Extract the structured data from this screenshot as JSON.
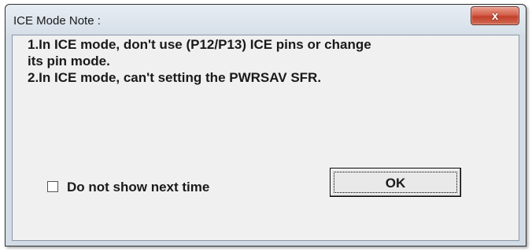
{
  "window": {
    "title": "ICE Mode Note :",
    "close_glyph": "x",
    "close_icon": "close-icon"
  },
  "message": {
    "text": "1.In ICE mode, don't use (P12/P13) ICE pins or change\nits pin mode.\n2.In ICE mode, can't setting the PWRSAV SFR."
  },
  "checkbox": {
    "label": "Do not show next time",
    "checked": false
  },
  "ok_button": {
    "label": "OK"
  },
  "colors": {
    "close_button": "#c2402b",
    "dialog_bg": "#f0f0f0",
    "frame": "#d3dce6"
  }
}
